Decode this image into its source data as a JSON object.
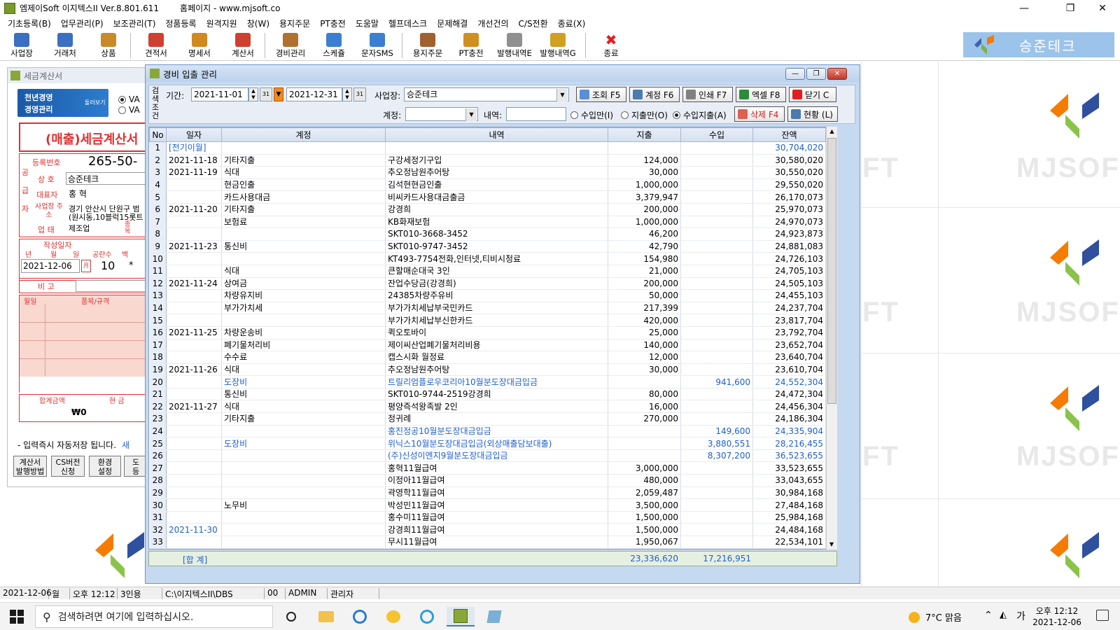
{
  "titlebar": {
    "title": "엠제이Soft 이지텍스II Ver.8.801.611",
    "homepage": "홈페이지 - www.mjsoft.co"
  },
  "menu": [
    "기초등록(B)",
    "업무관리(P)",
    "보조관리(T)",
    "정품등록",
    "원격지원",
    "창(W)",
    "용지주문",
    "PT충전",
    "도움말",
    "헬프데스크",
    "문제해결",
    "개선건의",
    "C/S전환",
    "종료(X)"
  ],
  "toolbar": [
    {
      "label": "사업장",
      "icon": "person-icon",
      "color": "#3b6fbf"
    },
    {
      "label": "거래처",
      "icon": "people-icon",
      "color": "#3b6fbf"
    },
    {
      "label": "상품",
      "icon": "box-icon",
      "color": "#c98a2a"
    },
    {
      "label": "견적서",
      "icon": "quote-doc-icon",
      "color": "#d04030"
    },
    {
      "label": "명세서",
      "icon": "statement-doc-icon",
      "color": "#d08a20"
    },
    {
      "label": "계산서",
      "icon": "invoice-doc-icon",
      "color": "#d04030"
    },
    {
      "label": "경비관리",
      "icon": "expense-icon",
      "color": "#b07030"
    },
    {
      "label": "스케쥴",
      "icon": "calendar-icon",
      "color": "#3a7fd0"
    },
    {
      "label": "문자SMS",
      "icon": "sms-icon",
      "color": "#3a7fd0"
    },
    {
      "label": "용지주문",
      "icon": "paper-order-icon",
      "color": "#a06030"
    },
    {
      "label": "PT충전",
      "icon": "coin-icon",
      "color": "#d09020"
    },
    {
      "label": "발행내역E",
      "icon": "envelope-icon",
      "color": "#909090"
    },
    {
      "label": "발행내역G",
      "icon": "flower-icon",
      "color": "#d0a020"
    },
    {
      "label": "종료",
      "icon": "close-x-icon",
      "color": "#e02020"
    }
  ],
  "brand": {
    "name": "승준테크"
  },
  "bg": {
    "mjsoft": "MJSOFT",
    "ft": "FT"
  },
  "invoice": {
    "window_title": "세금계산서",
    "banner_top": "천년경영",
    "banner_bottom": "경영관리",
    "banner_more": "둘러보기",
    "va1": "VA",
    "va2": "VA",
    "heading": "(매출)세금계산서",
    "supplier_side": "공급자",
    "reg_label": "등록번호",
    "reg_no": "265-50-",
    "name_label": "상 호",
    "name_value": "승준테크",
    "rep_label": "대표자",
    "rep_value": "홍 혁",
    "addr_label": "사업장 주소",
    "addr_value1": "경기 안산시 단원구 범",
    "addr_value2": "(원시동,10블럭15롯트",
    "biz_label": "업 태",
    "biz_value": "제조업",
    "biz_item": "종목",
    "date_section": "작성일자",
    "col_year": "년",
    "col_month": "월",
    "col_day": "일",
    "col_blank": "공란수",
    "col_hundred": "백",
    "date_value": "2021-12-06",
    "blank_count": "10",
    "star": "*",
    "memo_label": "비 고",
    "item_col1": "월일",
    "item_col2": "품목/규격",
    "total_label": "합계금액",
    "cash_label": "현 금",
    "total_value": "₩0",
    "autosave": "- 입력즉시 자동저장 됩니다.",
    "autosave_extra": "새",
    "btn1a": "계산서",
    "btn1b": "발행방법",
    "btn2a": "CS버전",
    "btn2b": "신청",
    "btn3a": "환경",
    "btn3b": "설정",
    "btn4a": "도",
    "btn4b": "등"
  },
  "main": {
    "title": "경비 입출 관리",
    "filter": {
      "side_label": "검색조건",
      "period_label": "기간:",
      "date_from": "2021-11-01",
      "date_to": "2021-12-31",
      "biz_label": "사업장:",
      "biz_value": "승준테크",
      "account_label": "계정:",
      "account_value": "",
      "desc_label": "내역:",
      "desc_value": "",
      "radio_income": "수입만(I)",
      "radio_expense": "지출만(O)",
      "radio_both": "수입지출(A)",
      "cal": "31"
    },
    "buttons": {
      "search": "조회 F5",
      "account": "계정 F6",
      "print": "인쇄 F7",
      "excel": "엑셀 F8",
      "close": "닫기 C",
      "delete": "삭제 F4",
      "status": "현황 (L)"
    },
    "columns": [
      "No",
      "일자",
      "계정",
      "내역",
      "지출",
      "수입",
      "잔액"
    ],
    "rows": [
      {
        "no": "1",
        "date": "[전기이월]",
        "acct": "",
        "desc": "",
        "out": "",
        "in": "",
        "bal": "30,704,020",
        "blue": true
      },
      {
        "no": "2",
        "date": "2021-11-18",
        "acct": "기타지출",
        "desc": "구강세정기구입",
        "out": "124,000",
        "in": "",
        "bal": "30,580,020"
      },
      {
        "no": "3",
        "date": "2021-11-19",
        "acct": "식대",
        "desc": "추오정남원추어탕",
        "out": "30,000",
        "in": "",
        "bal": "30,550,020"
      },
      {
        "no": "4",
        "date": "",
        "acct": "현금인출",
        "desc": "김석현현금인출",
        "out": "1,000,000",
        "in": "",
        "bal": "29,550,020"
      },
      {
        "no": "5",
        "date": "",
        "acct": "카드사용대금",
        "desc": "비씨카드사용대금출금",
        "out": "3,379,947",
        "in": "",
        "bal": "26,170,073"
      },
      {
        "no": "6",
        "date": "2021-11-20",
        "acct": "기타지출",
        "desc": "강경희",
        "out": "200,000",
        "in": "",
        "bal": "25,970,073"
      },
      {
        "no": "7",
        "date": "",
        "acct": "보험료",
        "desc": "KB화재보험",
        "out": "1,000,000",
        "in": "",
        "bal": "24,970,073"
      },
      {
        "no": "8",
        "date": "",
        "acct": "",
        "desc": "SKT010-3668-3452",
        "out": "46,200",
        "in": "",
        "bal": "24,923,873"
      },
      {
        "no": "9",
        "date": "2021-11-23",
        "acct": "통신비",
        "desc": "SKT010-9747-3452",
        "out": "42,790",
        "in": "",
        "bal": "24,881,083"
      },
      {
        "no": "10",
        "date": "",
        "acct": "",
        "desc": "KT493-7754전화,인터넷,티비시청료",
        "out": "154,980",
        "in": "",
        "bal": "24,726,103"
      },
      {
        "no": "11",
        "date": "",
        "acct": "식대",
        "desc": "큰할매순대국 3인",
        "out": "21,000",
        "in": "",
        "bal": "24,705,103"
      },
      {
        "no": "12",
        "date": "2021-11-24",
        "acct": "상여금",
        "desc": "잔업수당금(강경희)",
        "out": "200,000",
        "in": "",
        "bal": "24,505,103"
      },
      {
        "no": "13",
        "date": "",
        "acct": "차량유지비",
        "desc": "24385차량주유비",
        "out": "50,000",
        "in": "",
        "bal": "24,455,103"
      },
      {
        "no": "14",
        "date": "",
        "acct": "부가가치세",
        "desc": "부가가치세납부국민카드",
        "out": "217,399",
        "in": "",
        "bal": "24,237,704"
      },
      {
        "no": "15",
        "date": "",
        "acct": "",
        "desc": "부가가치세납부신한카드",
        "out": "420,000",
        "in": "",
        "bal": "23,817,704"
      },
      {
        "no": "16",
        "date": "2021-11-25",
        "acct": "차량운송비",
        "desc": "퀵오토바이",
        "out": "25,000",
        "in": "",
        "bal": "23,792,704"
      },
      {
        "no": "17",
        "date": "",
        "acct": "폐기물처리비",
        "desc": "제이씨산업폐기물처리비용",
        "out": "140,000",
        "in": "",
        "bal": "23,652,704"
      },
      {
        "no": "18",
        "date": "",
        "acct": "수수료",
        "desc": "캡스시화 월정료",
        "out": "12,000",
        "in": "",
        "bal": "23,640,704"
      },
      {
        "no": "19",
        "date": "2021-11-26",
        "acct": "식대",
        "desc": "추오정남원추어탕",
        "out": "30,000",
        "in": "",
        "bal": "23,610,704"
      },
      {
        "no": "20",
        "date": "",
        "acct": "도장비",
        "desc": "트릴리엄플로우코리아10월분도장대금입금",
        "out": "",
        "in": "941,600",
        "bal": "24,552,304",
        "blue": true
      },
      {
        "no": "21",
        "date": "",
        "acct": "통신비",
        "desc": "SKT010-9744-2519강경희",
        "out": "80,000",
        "in": "",
        "bal": "24,472,304"
      },
      {
        "no": "22",
        "date": "2021-11-27",
        "acct": "식대",
        "desc": "평양즉석왕족발 2인",
        "out": "16,000",
        "in": "",
        "bal": "24,456,304"
      },
      {
        "no": "23",
        "date": "",
        "acct": "기타지출",
        "desc": "정귀례",
        "out": "270,000",
        "in": "",
        "bal": "24,186,304"
      },
      {
        "no": "24",
        "date": "",
        "acct": "",
        "desc": "홍진정공10월분도장대금입금",
        "out": "",
        "in": "149,600",
        "bal": "24,335,904",
        "blue": true
      },
      {
        "no": "25",
        "date": "",
        "acct": "도장비",
        "desc": "위닉스10월분도장대금입금(외상매출담보대출)",
        "out": "",
        "in": "3,880,551",
        "bal": "28,216,455",
        "blue": true
      },
      {
        "no": "26",
        "date": "",
        "acct": "",
        "desc": "(주)신성이엔지9월분도장대금입금",
        "out": "",
        "in": "8,307,200",
        "bal": "36,523,655",
        "blue": true
      },
      {
        "no": "27",
        "date": "",
        "acct": "",
        "desc": "홍혁11월급여",
        "out": "3,000,000",
        "in": "",
        "bal": "33,523,655"
      },
      {
        "no": "28",
        "date": "",
        "acct": "",
        "desc": "이정아11월급여",
        "out": "480,000",
        "in": "",
        "bal": "33,043,655"
      },
      {
        "no": "29",
        "date": "",
        "acct": "",
        "desc": "곽영학11월급여",
        "out": "2,059,487",
        "in": "",
        "bal": "30,984,168"
      },
      {
        "no": "30",
        "date": "",
        "acct": "노무비",
        "desc": "박성민11월급여",
        "out": "3,500,000",
        "in": "",
        "bal": "27,484,168"
      },
      {
        "no": "31",
        "date": "",
        "acct": "",
        "desc": "홍수미11월급여",
        "out": "1,500,000",
        "in": "",
        "bal": "25,984,168"
      },
      {
        "no": "32",
        "date": "2021-11-30",
        "acct": "",
        "desc": "강경희11월급여",
        "out": "1,500,000",
        "in": "",
        "bal": "24,484,168"
      },
      {
        "no": "33",
        "date": "",
        "acct": "",
        "desc": "무시11월급여",
        "out": "1,950,067",
        "in": "",
        "bal": "22,534,101"
      }
    ],
    "totals": {
      "label": "[합 계]",
      "out": "23,336,620",
      "in": "17,216,951"
    }
  },
  "statusbar": [
    "2021-12-06",
    "월",
    "오후 12:12",
    "3인용",
    "C:\\이지텍스II\\DBS",
    "00",
    "ADMIN",
    "관리자"
  ],
  "taskbar": {
    "search_placeholder": "검색하려면 여기에 입력하십시오.",
    "weather": "7°C 맑음",
    "ime": "가",
    "time": "오후 12:12",
    "date": "2021-12-06"
  }
}
